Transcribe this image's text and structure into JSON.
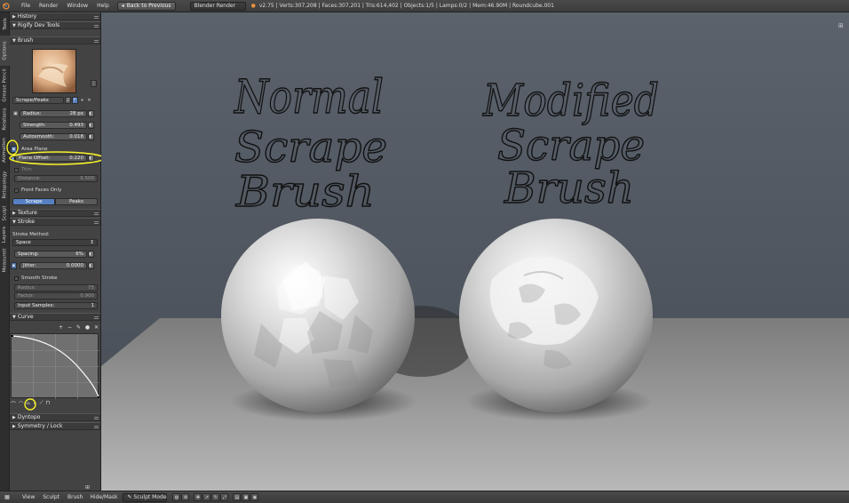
{
  "topbar": {
    "menus": [
      "File",
      "Render",
      "Window",
      "Help"
    ],
    "back_button": "Back to Previous",
    "engine": "Blender Render",
    "stats": "v2.75 | Verts:307,208 | Faces:307,201 | Tris:614,402 | Objects:1/5 | Lamps:0/2 | Mem:46.90M | Roundcube.001"
  },
  "vtabs": [
    "Tools",
    "Options",
    "Grease Pencil",
    "Relations",
    "Animation",
    "Retopology",
    "Sculpt",
    "Layers",
    "Measureit"
  ],
  "panel": {
    "history": "History",
    "rigify": "Rigify Dev Tools",
    "brush_header": "Brush",
    "brush_name": "Scrape/Peaks",
    "brush_users": "2",
    "brush_fake": "F",
    "radius_label": "Radius:",
    "radius_value": "28 px",
    "strength_label": "Strength:",
    "strength_value": "0.493",
    "autosmooth_label": "Autosmooth:",
    "autosmooth_value": "0.018",
    "area_plane": "Area Plane",
    "plane_offset_label": "Plane Offset:",
    "plane_offset_value": "0.220",
    "trim": "Trim",
    "distance_label": "Distance:",
    "distance_value": "0.500",
    "front_faces": "Front Faces Only",
    "mode_scrape": "Scrape",
    "mode_peaks": "Peaks",
    "texture": "Texture",
    "stroke": "Stroke",
    "stroke_method": "Stroke Method:",
    "stroke_method_value": "Space",
    "spacing_label": "Spacing:",
    "spacing_value": "6%",
    "jitter_label": "Jitter:",
    "jitter_value": "0.0000",
    "smooth_stroke": "Smooth Stroke",
    "ss_radius_label": "Radius:",
    "ss_radius_value": "75",
    "ss_factor_label": "Factor:",
    "ss_factor_value": "0.900",
    "input_samples_label": "Input Samples:",
    "input_samples_value": "1",
    "curve": "Curve",
    "dyntopo": "Dyntopo",
    "symmetry": "Symmetry / Lock"
  },
  "viewport": {
    "left_text": [
      "Normal",
      "Scrape",
      "Brush"
    ],
    "right_text": [
      "Modified",
      "Scrape",
      "Brush"
    ],
    "annotation_color": "#f5f02a"
  },
  "bottombar": {
    "menus": [
      "View",
      "Sculpt",
      "Brush",
      "Hide/Mask"
    ],
    "mode": "Sculpt Mode"
  }
}
